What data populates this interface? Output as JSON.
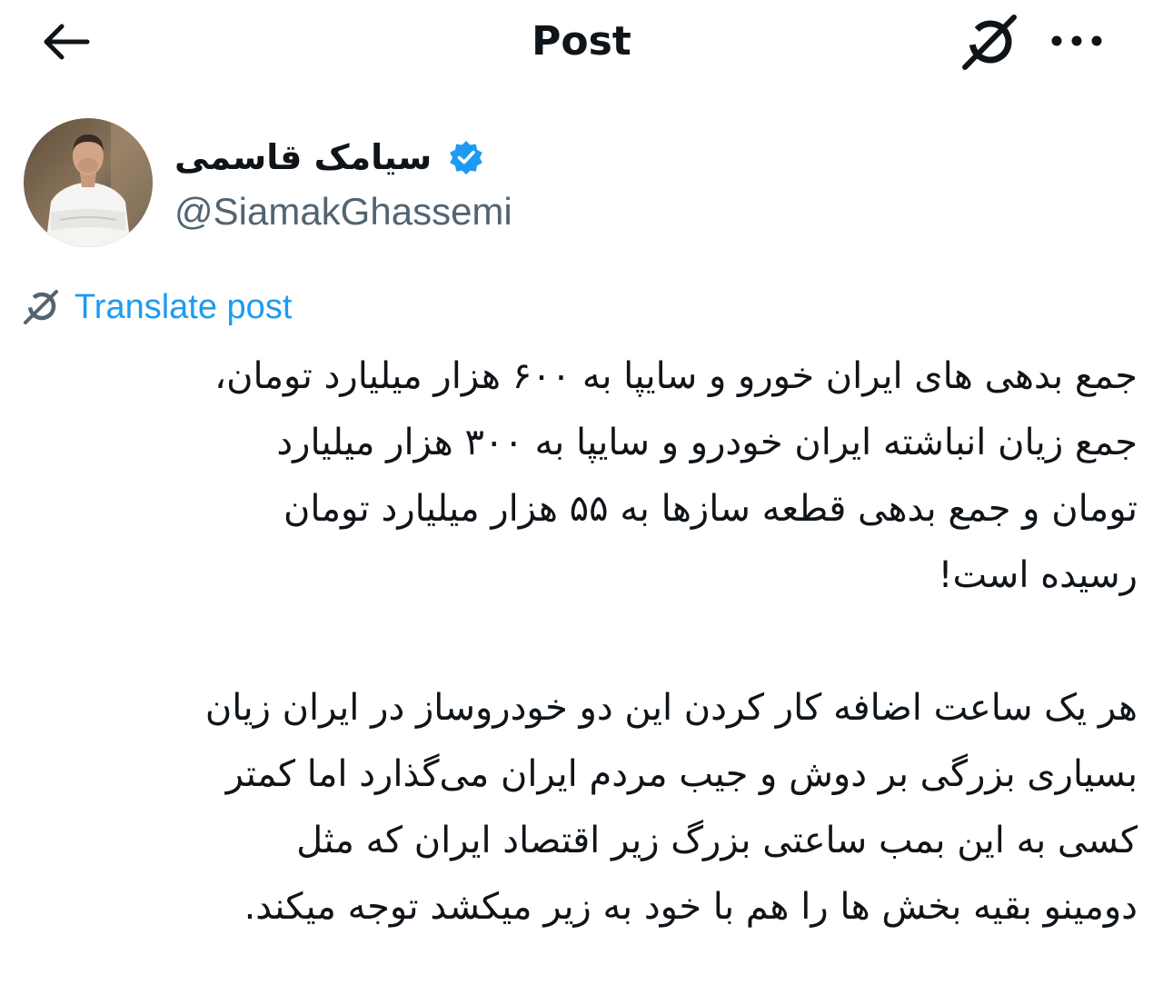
{
  "header": {
    "title": "Post",
    "back_icon": "arrow-left-icon",
    "grok_icon": "grok-icon",
    "more_icon": "more-horizontal-icon"
  },
  "author": {
    "name": "سیامک قاسمی",
    "handle": "@SiamakGhassemi",
    "verified": true,
    "verified_color": "#1d9bf0"
  },
  "translate": {
    "label": "Translate post",
    "icon": "grok-icon",
    "color": "#1d9bf0"
  },
  "post": {
    "lines": [
      "جمع بدهی های ایران خورو و سایپا به ۶۰۰ هزار میلیارد تومان،",
      "جمع زیان انباشته ایران خودرو و سایپا به ۳۰۰ هزار میلیارد",
      "تومان و جمع بدهی قطعه سازها به ۵۵ هزار میلیارد تومان",
      "رسیده است!",
      "",
      "هر یک ساعت اضافه کار کردن این دو خودروساز در ایران زیان",
      "بسیاری بزرگی بر دوش و جیب مردم ایران می‌گذارد اما کمتر",
      "کسی به این بمب ساعتی بزرگ زیر اقتصاد ایران که مثل",
      "دومینو بقیه بخش ها را هم با خود به زیر میکشد توجه میکند."
    ]
  }
}
